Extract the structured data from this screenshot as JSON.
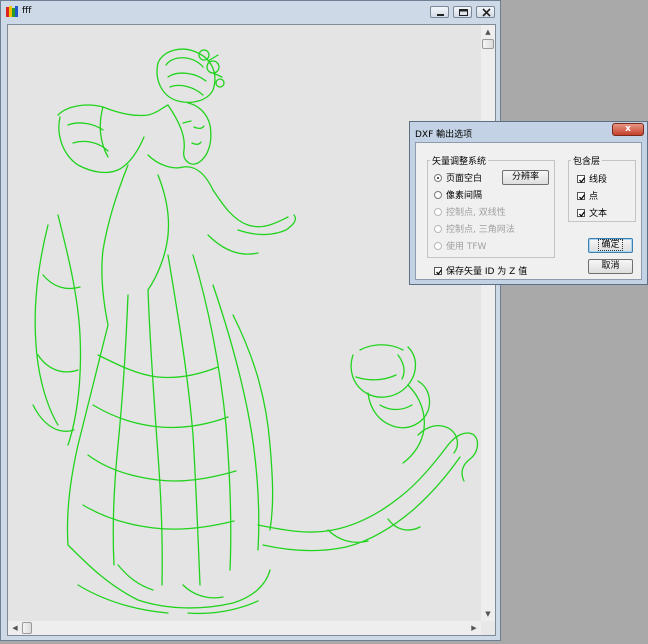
{
  "window": {
    "title": "fff",
    "icon": "colored-bars-app-icon",
    "buttons": [
      "minimize-icon",
      "maximize-icon",
      "close-icon"
    ]
  },
  "canvas": {
    "background": "#e4e4e4",
    "stroke_color": "#22d31e",
    "content": "green vector outline drawing of a traditional Chinese lady with flowing sleeves and ribbons"
  },
  "dialog": {
    "title": "DXF 輸出选项",
    "close_label": "x",
    "group_vector": {
      "label": "矢量调整系统",
      "options": [
        {
          "label": "页面空白",
          "selected": true,
          "enabled": true
        },
        {
          "label": "像素间隔",
          "selected": false,
          "enabled": true
        },
        {
          "label": "控制点, 双线性",
          "selected": false,
          "enabled": false
        },
        {
          "label": "控制点, 三角网法",
          "selected": false,
          "enabled": false
        },
        {
          "label": "使用 TFW",
          "selected": false,
          "enabled": false
        }
      ],
      "resolution_button": "分辨率"
    },
    "group_layers": {
      "label": "包含层",
      "items": [
        {
          "label": "线段",
          "checked": true
        },
        {
          "label": "点",
          "checked": true
        },
        {
          "label": "文本",
          "checked": true
        }
      ]
    },
    "ok_button": "确定",
    "cancel_button": "取消",
    "save_id_checkbox": {
      "label": "保存矢量 ID 为 Z 值",
      "checked": true
    }
  }
}
